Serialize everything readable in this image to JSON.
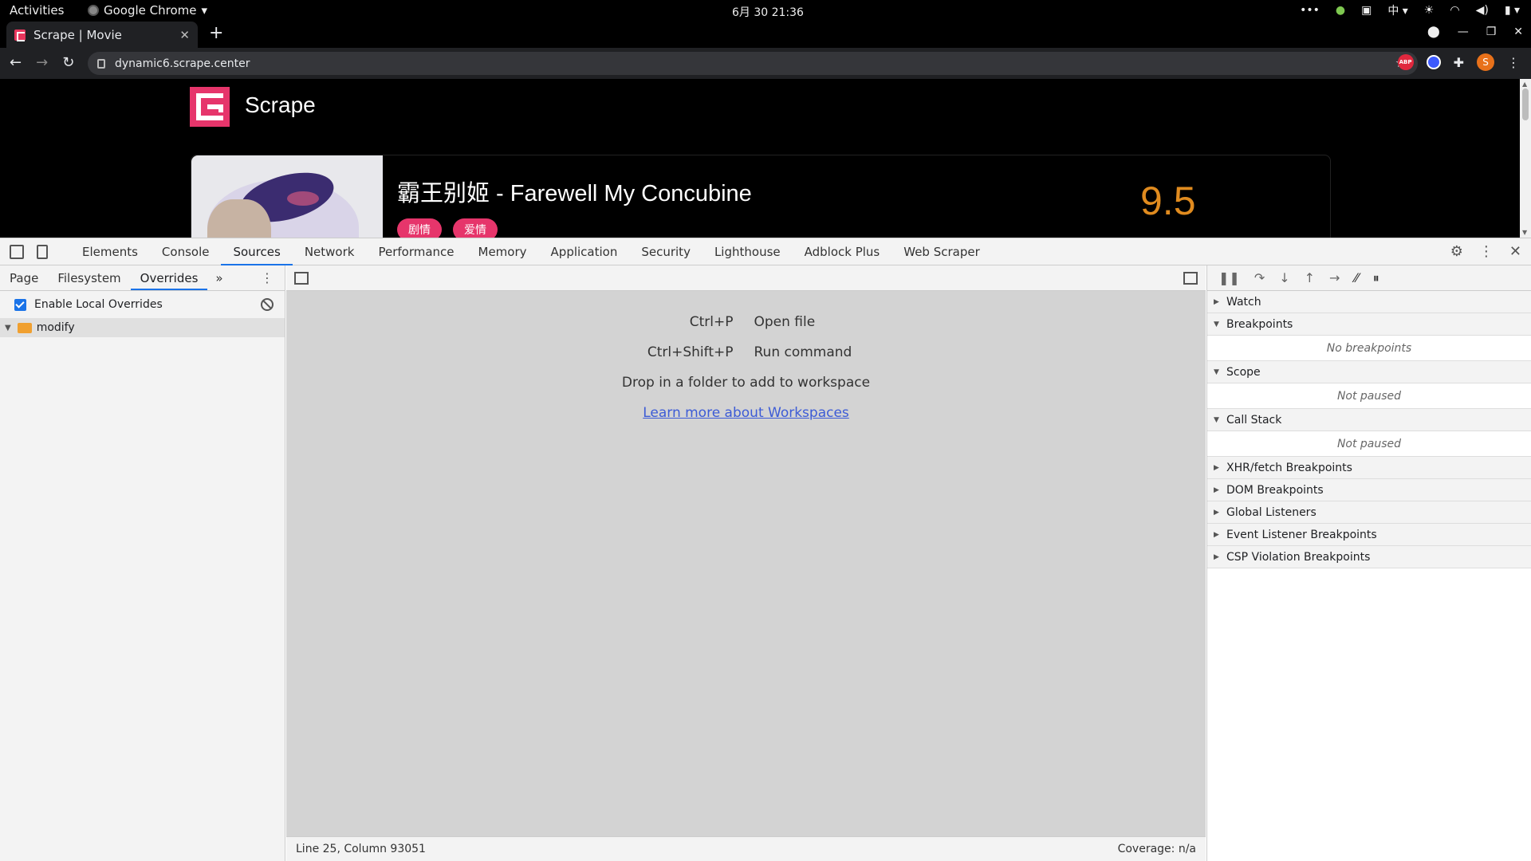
{
  "gnome": {
    "activities": "Activities",
    "app": "Google Chrome",
    "clock": "6月 30 21:36",
    "ime": "中"
  },
  "tab": {
    "title": "Scrape | Movie"
  },
  "omnibox": {
    "url": "dynamic6.scrape.center"
  },
  "extensions": {
    "abp": "ABP",
    "avatar": "S"
  },
  "site": {
    "brand": "Scrape",
    "movie_title": "霸王别姬 - Farewell My Concubine",
    "tags": [
      "剧情",
      "爱情"
    ],
    "score": "9.5"
  },
  "devtools": {
    "tabs": [
      "Elements",
      "Console",
      "Sources",
      "Network",
      "Performance",
      "Memory",
      "Application",
      "Security",
      "Lighthouse",
      "Adblock Plus",
      "Web Scraper"
    ],
    "active_tab": "Sources",
    "navigator_tabs": [
      "Page",
      "Filesystem",
      "Overrides"
    ],
    "navigator_more": "»",
    "enable_overrides": "Enable Local Overrides",
    "folder": "modify",
    "shortcuts": [
      {
        "key": "Ctrl+P",
        "action": "Open file"
      },
      {
        "key": "Ctrl+Shift+P",
        "action": "Run command"
      }
    ],
    "drop_hint": "Drop in a folder to add to workspace",
    "learn_link": "Learn more about Workspaces",
    "status_left": "Line 25, Column 93051",
    "status_right": "Coverage: n/a",
    "sections": {
      "watch": "Watch",
      "breakpoints": "Breakpoints",
      "no_breakpoints": "No breakpoints",
      "scope": "Scope",
      "scope_msg": "Not paused",
      "call_stack": "Call Stack",
      "call_stack_msg": "Not paused",
      "xhr": "XHR/fetch Breakpoints",
      "dom": "DOM Breakpoints",
      "global": "Global Listeners",
      "event": "Event Listener Breakpoints",
      "csp": "CSP Violation Breakpoints"
    }
  },
  "colors": {
    "accent": "#1a73e8",
    "brand": "#e6356b",
    "score": "#e08b1f"
  }
}
